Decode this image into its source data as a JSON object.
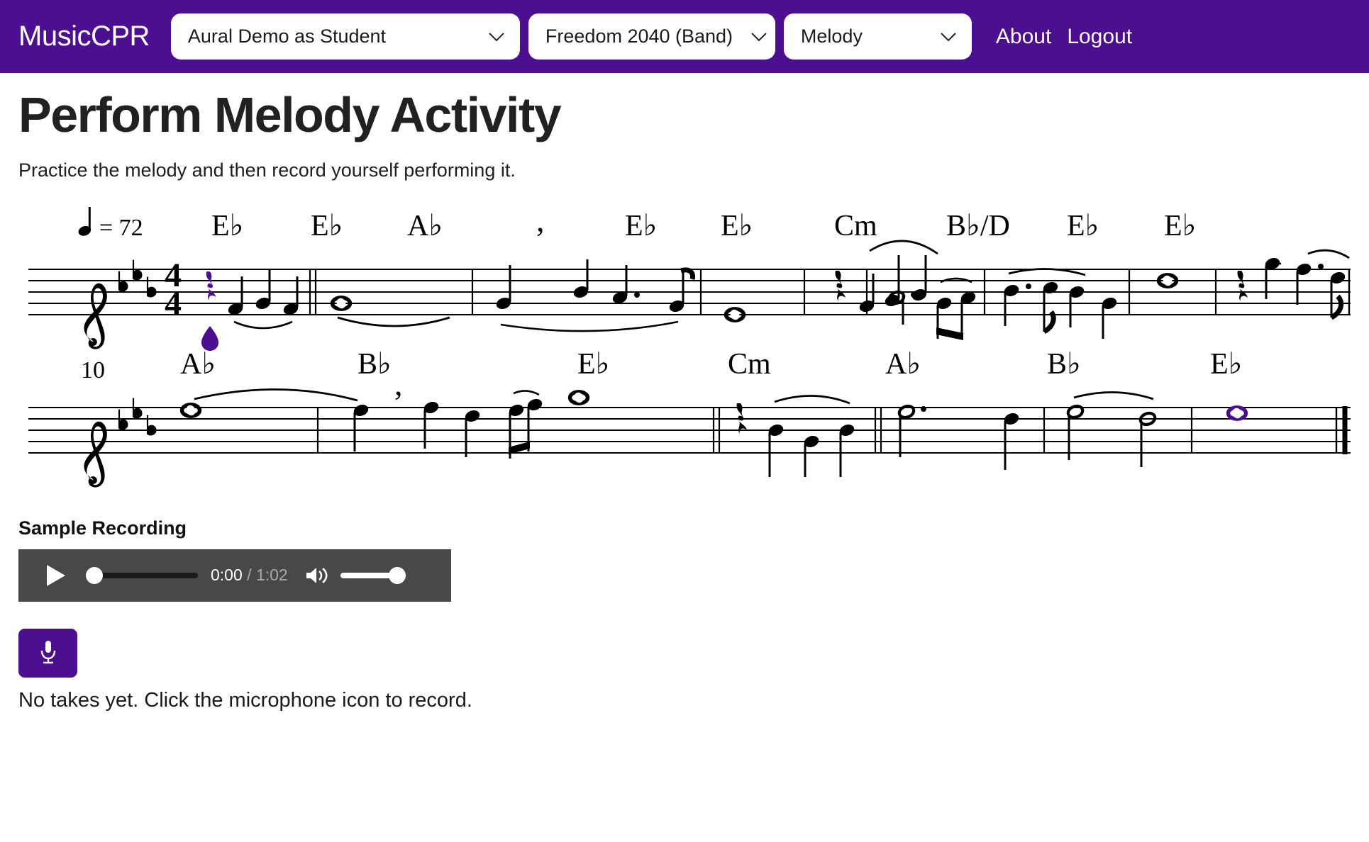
{
  "navbar": {
    "brand": "MusicCPR",
    "selects": [
      {
        "name": "activity-select",
        "value": "Aural Demo as Student"
      },
      {
        "name": "ensemble-select",
        "value": "Freedom 2040 (Band)"
      },
      {
        "name": "part-select",
        "value": "Melody"
      }
    ],
    "links": [
      {
        "name": "about-link",
        "label": "About"
      },
      {
        "name": "logout-link",
        "label": "Logout"
      }
    ],
    "background_color": "#4B0F8F"
  },
  "page": {
    "title": "Perform Melody Activity",
    "subtitle": "Practice the melody and then record yourself performing it."
  },
  "score": {
    "tempo_text": "= 72",
    "tempo_bpm": 72,
    "time_signature_top": "4",
    "time_signature_bottom": "4",
    "key_signature_flats": 3,
    "key_name": "E♭ major",
    "clef": "treble",
    "system1_chords": [
      "E♭",
      "E♭",
      "A♭",
      "E♭",
      "E♭",
      "Cm",
      "B♭/D",
      "E♭",
      "E♭"
    ],
    "system2_measure_number": "10",
    "system2_chords": [
      "A♭",
      "B♭",
      "E♭",
      "Cm",
      "A♭",
      "B♭",
      "E♭"
    ],
    "highlight_color": "#4B0F8F",
    "cursor_marker": "teardrop"
  },
  "sample_recording": {
    "heading": "Sample Recording",
    "current_time": "0:00",
    "separator": "/",
    "duration": "1:02",
    "play_icon": "play-icon",
    "volume_icon": "volume-icon",
    "background_color": "#484848"
  },
  "recording": {
    "mic_icon": "microphone-icon",
    "status_text": "No takes yet. Click the microphone icon to record.",
    "button_color": "#4B0F8F"
  }
}
